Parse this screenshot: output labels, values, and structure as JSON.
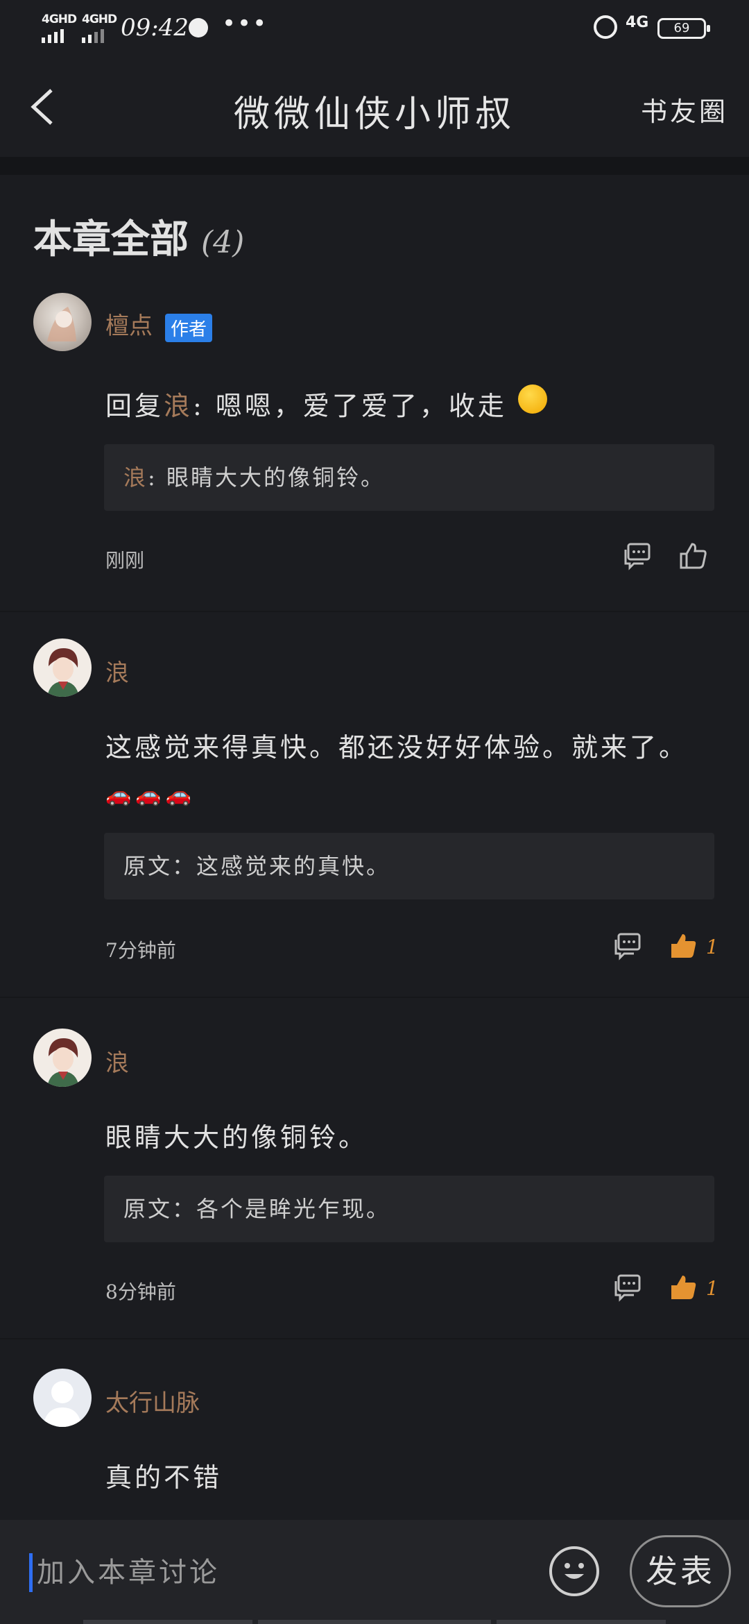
{
  "status_bar": {
    "signal_1": "4GHD",
    "signal_2": "4GHD",
    "time": "09:42",
    "dots": "•••",
    "network": "4G",
    "battery": "69"
  },
  "header": {
    "title": "微微仙侠小师叔",
    "right_link": "书友圈"
  },
  "section": {
    "title": "本章全部",
    "count": "(4)"
  },
  "comments": [
    {
      "username": "檀点",
      "badge": "作者",
      "reply_prefix": "回复",
      "reply_user": "浪",
      "text": ": 嗯嗯，爱了爱了，收走",
      "quote_user": "浪",
      "quote_text": ": 眼睛大大的像铜铃。",
      "time": "刚刚",
      "likes": ""
    },
    {
      "username": "浪",
      "text": "这感觉来得真快。都还没好好体验。就来了。",
      "emoji_line": "🚗🚗🚗",
      "quote_text": "原文：这感觉来的真快。",
      "time": "7分钟前",
      "likes": "1"
    },
    {
      "username": "浪",
      "text": "眼睛大大的像铜铃。",
      "quote_text": "原文：各个是眸光乍现。",
      "time": "8分钟前",
      "likes": "1"
    },
    {
      "username": "太行山脉",
      "text": "真的不错"
    }
  ],
  "input": {
    "placeholder": "加入本章讨论"
  },
  "post_button": "发表",
  "colors": {
    "background": "#1b1c20",
    "username": "#a57a5a",
    "like_active": "#e49331",
    "badge": "#2b7fe8"
  }
}
